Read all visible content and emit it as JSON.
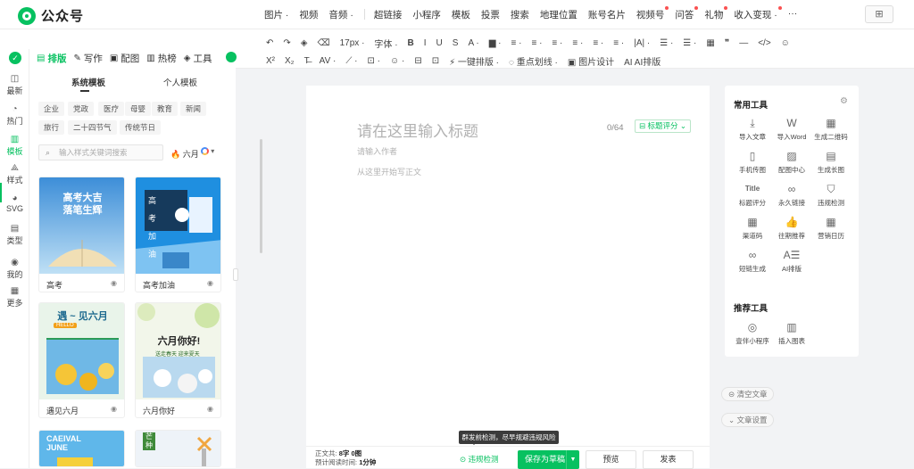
{
  "app": {
    "name": "公众号"
  },
  "topmenu": [
    {
      "label": "图片 ·",
      "dot": false
    },
    {
      "label": "视频",
      "dot": false
    },
    {
      "label": "音频 ·",
      "dot": false
    },
    {
      "label": "超链接",
      "dot": false
    },
    {
      "label": "小程序",
      "dot": false
    },
    {
      "label": "模板",
      "dot": false
    },
    {
      "label": "投票",
      "dot": false
    },
    {
      "label": "搜索",
      "dot": false
    },
    {
      "label": "地理位置",
      "dot": false
    },
    {
      "label": "账号名片",
      "dot": false
    },
    {
      "label": "视频号",
      "dot": true
    },
    {
      "label": "问答",
      "dot": true
    },
    {
      "label": "礼物",
      "dot": true
    },
    {
      "label": "收入变现 ·",
      "dot": true
    },
    {
      "label": "···",
      "dot": false
    }
  ],
  "toolbar": {
    "row1": [
      "↶",
      "↷",
      "◈",
      "⌫",
      "17px ·",
      "字体 ·",
      "B",
      "I",
      "U",
      "S",
      "A ·",
      "▆ ·",
      "≡ ·",
      "≡ ·",
      "≡ ·",
      "≡ ·",
      "≡ ·",
      "≡ ·",
      "|A| ·",
      "☰ ·",
      "☰ ·",
      "▦",
      "❞",
      "—",
      "</>",
      "☺"
    ],
    "row2": [
      "X²",
      "X₂",
      "T̶",
      "AV ·",
      "⟋ ·",
      "⊡ ·",
      "☺ ·",
      "⊟",
      "⊡",
      "⚡ 一键排版 ·",
      "◌ 重点划线 ·",
      "▣ 图片设计",
      "AI AI排版"
    ]
  },
  "leftnav": [
    {
      "icon": "◫",
      "label": "最新"
    },
    {
      "icon": "◔",
      "label": "热门"
    },
    {
      "icon": "▥",
      "label": "模板"
    },
    {
      "icon": "⟁",
      "label": "样式"
    },
    {
      "icon": "◕",
      "label": "SVG"
    },
    {
      "icon": "▤",
      "label": "类型"
    },
    {
      "icon": "◉",
      "label": "我的"
    },
    {
      "icon": "▦",
      "label": "更多"
    }
  ],
  "panel": {
    "tabs": [
      {
        "icon": "▤",
        "label": "排版"
      },
      {
        "icon": "✎",
        "label": "写作"
      },
      {
        "icon": "▣",
        "label": "配图"
      },
      {
        "icon": "▥",
        "label": "热榜"
      },
      {
        "icon": "◈",
        "label": "工具"
      }
    ],
    "subtabs": [
      "系统模板",
      "个人模板"
    ],
    "categories": [
      "企业",
      "党政",
      "医疗",
      "母婴",
      "教育",
      "新闻",
      "旅行",
      "二十四节气",
      "传统节日"
    ],
    "search_placeholder": "输入样式关键词搜索",
    "month_label": "六月",
    "cards": [
      {
        "caption": "高考",
        "art_title": "高考大吉",
        "art_sub": "落笔生辉"
      },
      {
        "caption": "高考加油",
        "art_title": "高 考 加 油",
        "art_sub": ""
      },
      {
        "caption": "遇见六月",
        "art_title": "遇 ~ 见六月",
        "art_sub": "HELLO"
      },
      {
        "caption": "六月你好",
        "art_title": "六月你好!",
        "art_sub": "送走春天 迎来夏天"
      },
      {
        "caption": "",
        "art_title": "CAEIVAL JUNE",
        "art_sub": ""
      },
      {
        "caption": "",
        "art_title": "芒种",
        "art_sub": ""
      }
    ]
  },
  "editor": {
    "title_placeholder": "请在这里输入标题",
    "counter": "0/64",
    "score_label": "⊟ 标题评分 ⌄",
    "author_placeholder": "请输入作者",
    "body_placeholder": "从这里开始写正文"
  },
  "rightpanel": {
    "common_title": "常用工具",
    "common_tools": [
      {
        "icon": "⤓",
        "label": "导入文章"
      },
      {
        "icon": "W",
        "label": "导入Word"
      },
      {
        "icon": "▦",
        "label": "生成二维码"
      },
      {
        "icon": "▯",
        "label": "手机传图"
      },
      {
        "icon": "▨",
        "label": "配图中心"
      },
      {
        "icon": "▤",
        "label": "生成长图"
      },
      {
        "icon": "Title",
        "label": "标题评分"
      },
      {
        "icon": "∞",
        "label": "永久链接"
      },
      {
        "icon": "⛉",
        "label": "违规检测"
      },
      {
        "icon": "▦",
        "label": "渠道码"
      },
      {
        "icon": "👍",
        "label": "往期推荐"
      },
      {
        "icon": "▦",
        "label": "营销日历"
      },
      {
        "icon": "∞",
        "label": "短链生成"
      },
      {
        "icon": "A☰",
        "label": "AI排版"
      }
    ],
    "rec_title": "推荐工具",
    "rec_tools": [
      {
        "icon": "◎",
        "label": "壹伴小程序"
      },
      {
        "icon": "▥",
        "label": "插入图表"
      }
    ],
    "clear_label": "⊝ 清空文章",
    "settings_label": "⌄ 文章设置"
  },
  "bottom": {
    "word_count_label": "正文共:",
    "word_count_value": "8字 0图",
    "read_time_label": "预计阅读时间:",
    "read_time_value": "1分钟",
    "check_label": "⊙ 违规检测",
    "save_label": "保存为草稿",
    "preview_label": "预览",
    "publish_label": "发表",
    "tooltip": "群发前检测，尽早规避违规风险"
  },
  "colors": {
    "accent": "#07c160"
  }
}
